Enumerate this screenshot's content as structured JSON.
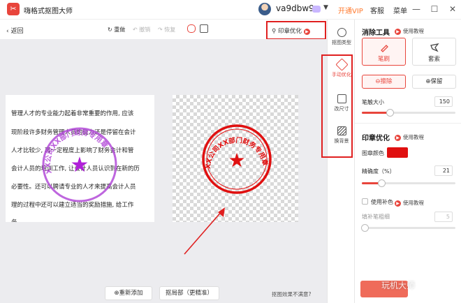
{
  "app": {
    "title": "嗨格式抠图大师",
    "logo_glyph": "✂",
    "accent": "#e8453c",
    "highlight": "#e02020"
  },
  "user": {
    "name": "va9dbw9",
    "open_vip": "开通VIP",
    "service": "客服",
    "menu": "菜单"
  },
  "toolbar": {
    "back": "返回",
    "redo": "重做",
    "undo": "撤销",
    "restore": "恢复",
    "stamp_optimize": "印章优化"
  },
  "tools_strip": {
    "items": [
      {
        "label": "抠图类型",
        "icon": "toggle-icon"
      },
      {
        "label": "手动优化",
        "icon": "eraser-icon"
      },
      {
        "label": "改尺寸",
        "icon": "crop-icon"
      },
      {
        "label": "换背景",
        "icon": "background-icon"
      }
    ]
  },
  "document": {
    "lines": [
      "管理人才的专业能力起着非常重要的作用, 应该",
      "现阶段许多财务管理人员的能力还是停留在会计",
      "人才比较少, 再一定程度上影响了财务会计和管",
      "会计人员的培训工作, 让会计人员认识到在新的历",
      "必要性。还可以聘请专业的人才来提高会计人员",
      "理的过程中还可以建立适当的奖励措施, 给工作",
      "务。"
    ]
  },
  "stamp": {
    "text": "XX公司XX部门财务专用章",
    "star": "★"
  },
  "canvas_footer": {
    "reset": "重新添加",
    "redo_cut": "抠局部（更精准）",
    "hint": "抠图效果不满意?"
  },
  "panel": {
    "erase_tool": {
      "title": "消除工具",
      "help": "使用教程",
      "modes": [
        {
          "label": "笔刷",
          "icon": "brush-icon",
          "active": true
        },
        {
          "label": "套索",
          "icon": "lasso-icon",
          "active": false
        }
      ],
      "erase_label": "擦除",
      "keep_label": "保留",
      "brush_size_label": "笔触大小",
      "brush_size_value": "150",
      "brush_size_fraction": 0.3
    },
    "stamp_opt": {
      "title": "印章优化",
      "help": "使用教程",
      "color_label": "图章颜色",
      "color": "#e01010",
      "precision_label": "精确度（%）",
      "precision_value": "21",
      "precision_fraction": 0.21,
      "fill_label": "使用补色",
      "fill_help": "使用教程",
      "fill_brush_label": "填补笔粗细",
      "fill_brush_value": "5",
      "fill_brush_fraction": 0.03
    }
  },
  "watermark": "玩机大师"
}
